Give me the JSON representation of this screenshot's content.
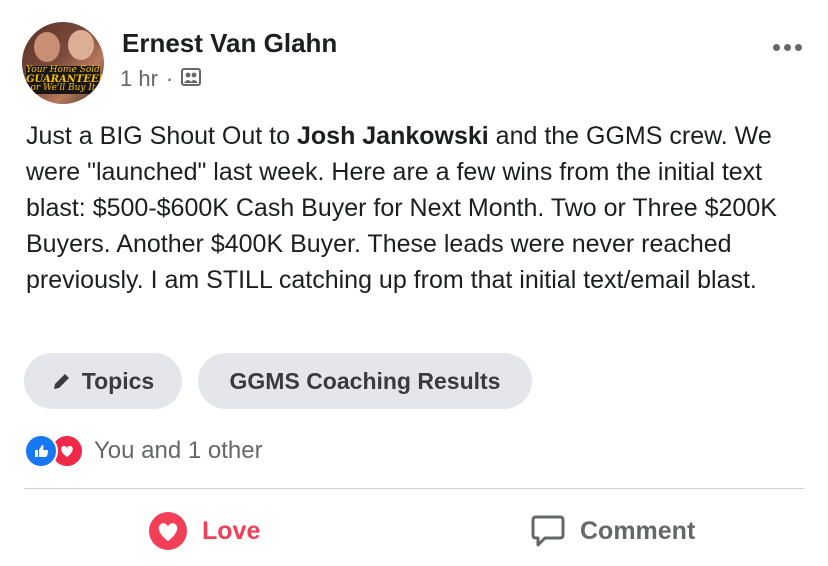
{
  "post": {
    "author": "Ernest Van Glahn",
    "time": "1 hr",
    "separator": "·",
    "audience_icon": "group-icon",
    "avatar_text": {
      "line1": "Your Home Sold",
      "line2": "GUARANTEED",
      "line3": "or We'll Buy It"
    },
    "body_part1": "Just a BIG Shout Out to ",
    "body_bold": "Josh Jankowski",
    "body_part2": " and the GGMS crew. We were \"launched\" last week. Here are a few wins from the initial text blast: $500-$600K Cash Buyer for Next Month. Two or Three $200K Buyers. Another $400K Buyer. These leads were never reached previously. I am STILL catching up from that initial text/email blast."
  },
  "topics": {
    "label": "Topics",
    "icon": "pencil-icon",
    "items": [
      "GGMS Coaching Results"
    ]
  },
  "reactions": {
    "text": "You and 1 other",
    "types": [
      "like",
      "love"
    ]
  },
  "actions": {
    "love_label": "Love",
    "comment_label": "Comment"
  },
  "colors": {
    "like": "#1877f2",
    "love": "#f33e58",
    "chip_bg": "#e4e6eb",
    "secondary_text": "#65676b"
  }
}
